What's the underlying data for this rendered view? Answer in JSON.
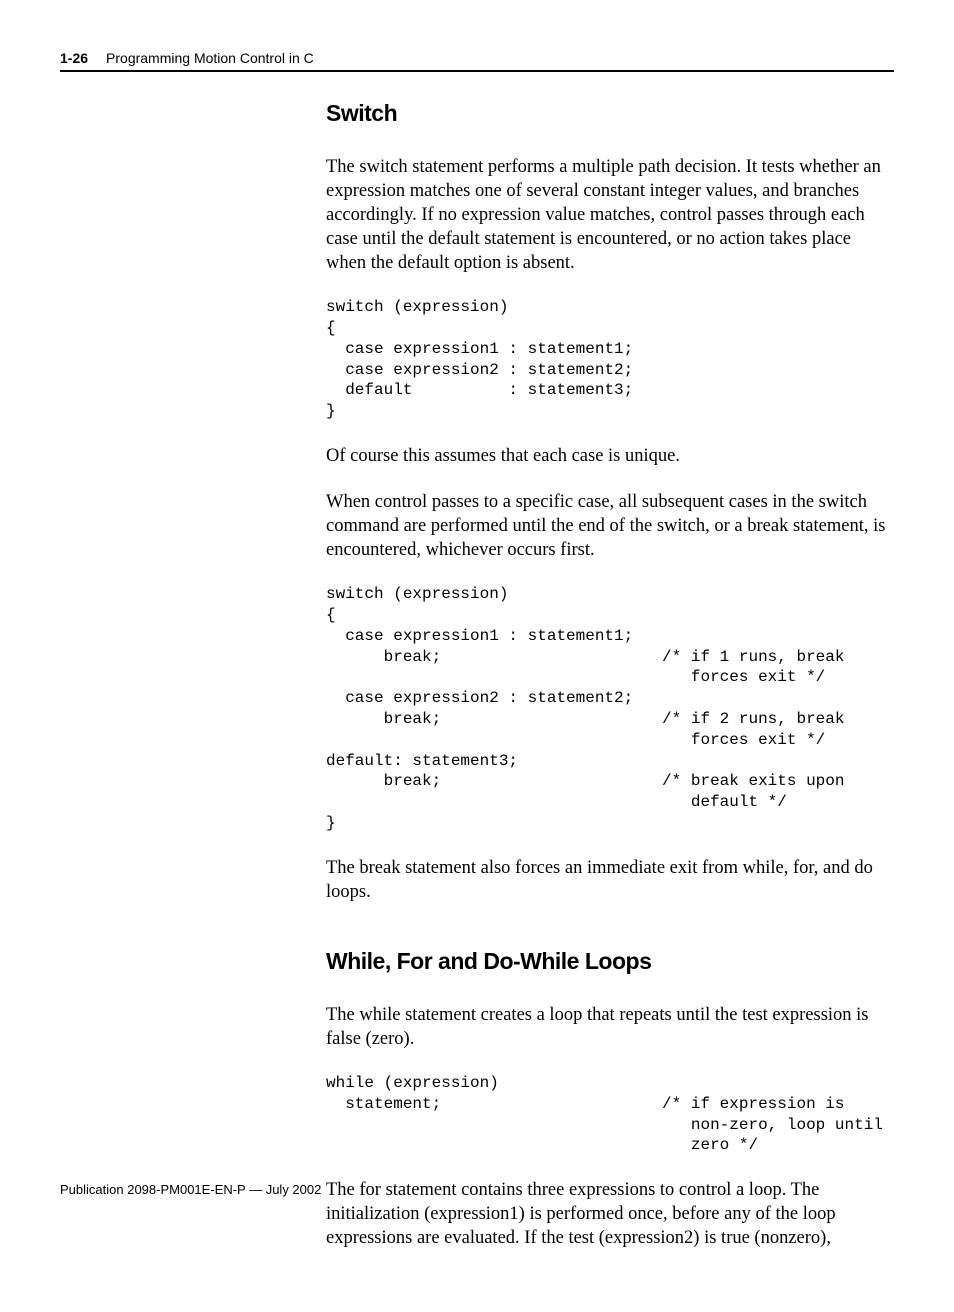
{
  "header": {
    "page_num": "1-26",
    "title": "Programming Motion Control in C"
  },
  "section1": {
    "heading": "Switch",
    "para1": "The switch statement performs a multiple path decision. It tests whether an expression matches one of several constant integer values, and branches accordingly. If no expression value matches, control passes through each case until the default statement is encountered, or no action takes place when the default option is absent.",
    "code1": "switch (expression)\n{\n  case expression1 : statement1;\n  case expression2 : statement2;\n  default          : statement3;\n}",
    "para2": "Of course this assumes that each case is unique.",
    "para3": "When control passes to a specific case, all subsequent cases in the switch command are performed until the end of the switch, or a break statement, is encountered, whichever occurs first.",
    "code2": "switch (expression)\n{\n  case expression1 : statement1;\n      break;                       /* if 1 runs, break\n                                      forces exit */\n  case expression2 : statement2;\n      break;                       /* if 2 runs, break\n                                      forces exit */\ndefault: statement3;\n      break;                       /* break exits upon\n                                      default */\n}",
    "para4": "The break statement also forces an immediate exit from while, for, and do loops."
  },
  "section2": {
    "heading": "While, For and Do-While Loops",
    "para1": "The while statement creates a loop that repeats until the test expression is false (zero).",
    "code1": "while (expression)\n  statement;                       /* if expression is\n                                      non-zero, loop until\n                                      zero */",
    "para2": "The for statement contains three expressions to control a loop. The initialization (expression1) is performed once, before any of the loop expressions are evaluated. If the test (expression2) is true (nonzero),"
  },
  "footer": "Publication 2098-PM001E-EN-P — July 2002"
}
